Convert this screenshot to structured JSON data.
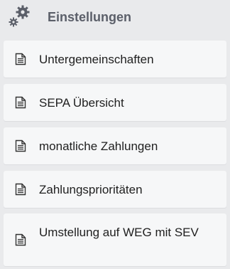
{
  "header": {
    "title": "Einstellungen",
    "icon": "gears-icon",
    "icon_color": "#5b5f69"
  },
  "menu": {
    "items": [
      {
        "label": "Untergemeinschaften",
        "icon": "document-icon"
      },
      {
        "label": "SEPA Übersicht",
        "icon": "document-icon"
      },
      {
        "label": "monatliche Zahlungen",
        "icon": "document-icon"
      },
      {
        "label": "Zahlungsprioritäten",
        "icon": "document-icon"
      },
      {
        "label": "Umstellung auf WEG mit SEV",
        "icon": "document-icon"
      }
    ]
  },
  "colors": {
    "background": "#e9eaec",
    "item_background": "#f6f7f8",
    "text": "#1f1f1f"
  }
}
